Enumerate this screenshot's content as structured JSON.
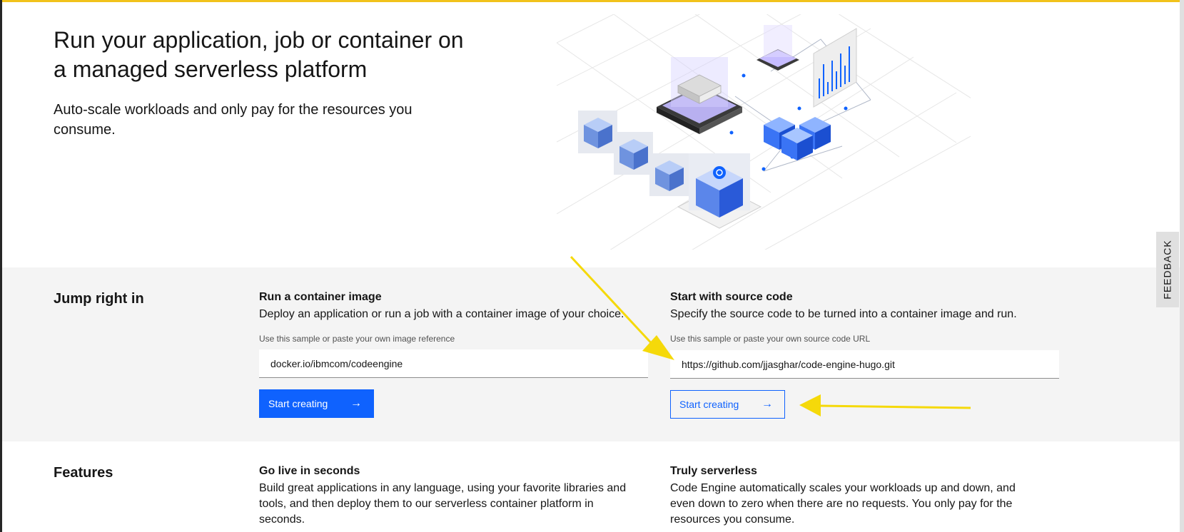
{
  "hero": {
    "title": "Run your application, job or container on a managed serverless platform",
    "subtitle": "Auto-scale workloads and only pay for the resources you consume."
  },
  "jump": {
    "heading": "Jump right in",
    "container": {
      "title": "Run a container image",
      "description": "Deploy an application or run a job with a container image of your choice.",
      "field_label": "Use this sample or paste your own image reference",
      "input_value": "docker.io/ibmcom/codeengine",
      "button_label": "Start creating"
    },
    "source": {
      "title": "Start with source code",
      "description": "Specify the source code to be turned into a container image and run.",
      "field_label": "Use this sample or paste your own source code URL",
      "input_value": "https://github.com/jjasghar/code-engine-hugo.git",
      "button_label": "Start creating"
    }
  },
  "features": {
    "heading": "Features",
    "items": [
      {
        "title": "Go live in seconds",
        "description": "Build great applications in any language, using your favorite libraries and tools, and then deploy them to our serverless container platform in seconds."
      },
      {
        "title": "Truly serverless",
        "description": "Code Engine automatically scales your workloads up and down, and even down to zero when there are no requests. You only pay for the resources you consume."
      }
    ]
  },
  "feedback": {
    "label": "FEEDBACK"
  },
  "icons": {
    "button_arrow": "arrow-right-icon",
    "illustration": "serverless-platform-illustration",
    "annotation": "yellow-pointer-arrow"
  },
  "colors": {
    "primary": "#0f62fe",
    "band": "#f4f4f4",
    "annotation": "#f5d90a",
    "top_strip": "#f1c21b"
  }
}
